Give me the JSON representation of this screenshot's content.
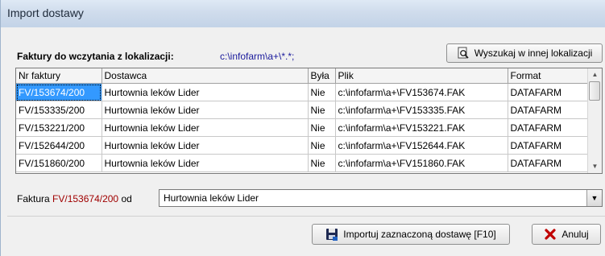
{
  "window": {
    "title": "Import dostawy"
  },
  "header": {
    "label": "Faktury do wczytania z lokalizacji:",
    "path": "c:\\infofarm\\a+\\*.*;"
  },
  "buttons": {
    "search_other": "Wyszukaj w innej lokalizacji",
    "import": "Importuj zaznaczoną dostawę [F10]",
    "cancel": "Anuluj"
  },
  "table": {
    "columns": [
      "Nr faktury",
      "Dostawca",
      "Była",
      "Plik",
      "Format"
    ],
    "rows": [
      [
        "FV/153674/200",
        "Hurtownia leków Lider",
        "Nie",
        "c:\\infofarm\\a+\\FV153674.FAK",
        "DATAFARM"
      ],
      [
        "FV/153335/200",
        "Hurtownia leków Lider",
        "Nie",
        "c:\\infofarm\\a+\\FV153335.FAK",
        "DATAFARM"
      ],
      [
        "FV/153221/200",
        "Hurtownia leków Lider",
        "Nie",
        "c:\\infofarm\\a+\\FV153221.FAK",
        "DATAFARM"
      ],
      [
        "FV/152644/200",
        "Hurtownia leków Lider",
        "Nie",
        "c:\\infofarm\\a+\\FV152644.FAK",
        "DATAFARM"
      ],
      [
        "FV/151860/200",
        "Hurtownia leków Lider",
        "Nie",
        "c:\\infofarm\\a+\\FV151860.FAK",
        "DATAFARM"
      ]
    ],
    "selected_row": 0
  },
  "footer": {
    "prefix": "Faktura",
    "invoice": "FV/153674/200",
    "from": "od",
    "supplier": "Hurtownia leków Lider"
  },
  "icons": {
    "search": "magnifier-document-icon",
    "import": "floppy-import-icon",
    "cancel": "red-x-icon"
  }
}
